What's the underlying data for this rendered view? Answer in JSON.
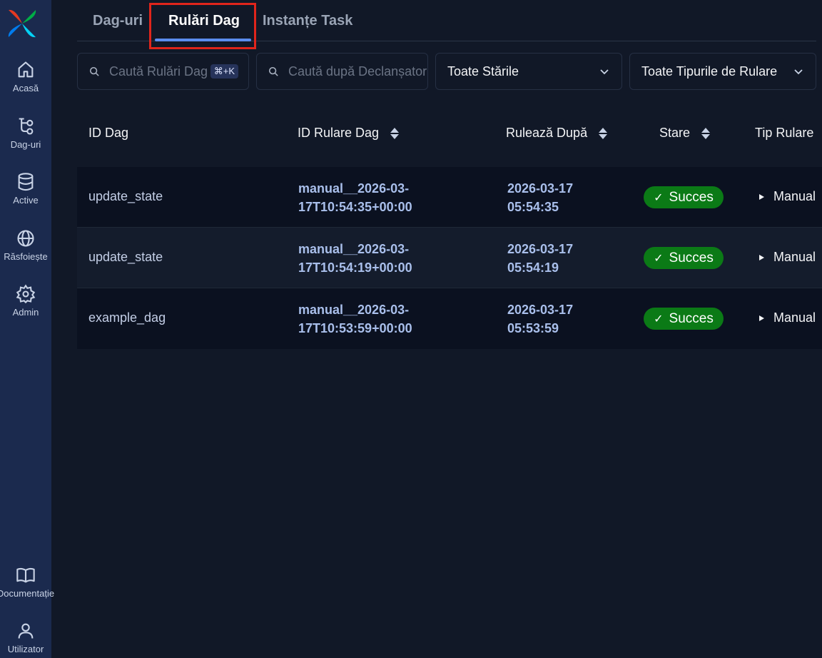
{
  "sidebar": {
    "items": [
      {
        "label": "Acasă",
        "icon": "home-icon"
      },
      {
        "label": "Dag-uri",
        "icon": "dag-icon"
      },
      {
        "label": "Active",
        "icon": "database-icon"
      },
      {
        "label": "Răsfoiește",
        "icon": "globe-icon"
      },
      {
        "label": "Admin",
        "icon": "gear-icon"
      },
      {
        "label": "Documentație",
        "icon": "book-icon"
      },
      {
        "label": "Utilizator",
        "icon": "user-icon"
      }
    ]
  },
  "tabs": [
    {
      "label": "Dag-uri"
    },
    {
      "label": "Rulări Dag",
      "active": true
    },
    {
      "label": "Instanțe Task"
    }
  ],
  "filters": {
    "search_runs_placeholder": "Caută Rulări Dag",
    "search_runs_shortcut": "⌘+K",
    "search_trigger_placeholder": "Caută după Declanșator",
    "state_select": "Toate Stările",
    "run_type_select": "Toate Tipurile de Rulare"
  },
  "table": {
    "headers": [
      "ID Dag",
      "ID Rulare Dag",
      "Rulează După",
      "Stare",
      "Tip Rulare"
    ],
    "rows": [
      {
        "dag_id": "update_state",
        "run_id_1": "manual__2026-03-",
        "run_id_2": "17T10:54:35+00:00",
        "after_1": "2026-03-17",
        "after_2": "05:54:35",
        "state": "Succes",
        "run_type": "Manual"
      },
      {
        "dag_id": "update_state",
        "run_id_1": "manual__2026-03-",
        "run_id_2": "17T10:54:19+00:00",
        "after_1": "2026-03-17",
        "after_2": "05:54:19",
        "state": "Succes",
        "run_type": "Manual"
      },
      {
        "dag_id": "example_dag",
        "run_id_1": "manual__2026-03-",
        "run_id_2": "17T10:53:59+00:00",
        "after_1": "2026-03-17",
        "after_2": "05:53:59",
        "state": "Succes",
        "run_type": "Manual"
      }
    ]
  },
  "colors": {
    "sidebar_bg": "#1b2a4e",
    "page_bg": "#111827",
    "accent": "#5b8def",
    "success": "#0b7a16",
    "highlight": "#e0251b"
  }
}
